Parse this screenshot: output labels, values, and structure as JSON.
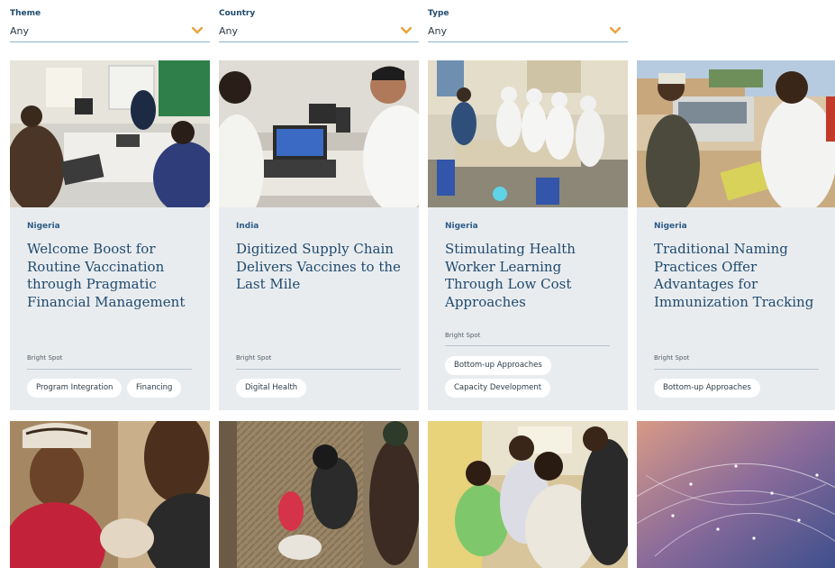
{
  "filters": [
    {
      "label": "Theme",
      "value": "Any"
    },
    {
      "label": "Country",
      "value": "Any"
    },
    {
      "label": "Type",
      "value": "Any"
    }
  ],
  "cards": [
    {
      "country": "Nigeria",
      "title": "Welcome Boost for Routine Vaccination through Pragmatic Financial Management",
      "type": "Bright Spot",
      "tags": [
        "Program Integration",
        "Financing"
      ]
    },
    {
      "country": "India",
      "title": "Digitized Supply Chain Delivers Vaccines to the Last Mile",
      "type": "Bright Spot",
      "tags": [
        "Digital Health"
      ]
    },
    {
      "country": "Nigeria",
      "title": "Stimulating Health Worker Learning Through Low Cost Approaches",
      "type": "Bright Spot",
      "tags": [
        "Bottom-up Approaches",
        "Capacity Development"
      ]
    },
    {
      "country": "Nigeria",
      "title": "Traditional Naming Practices Offer Advantages for Immunization Tracking",
      "type": "Bright Spot",
      "tags": [
        "Bottom-up Approaches"
      ]
    }
  ],
  "colors": {
    "accent": "#e8a33d",
    "title": "#1f4a6e",
    "card_bg": "#e9ecef"
  }
}
